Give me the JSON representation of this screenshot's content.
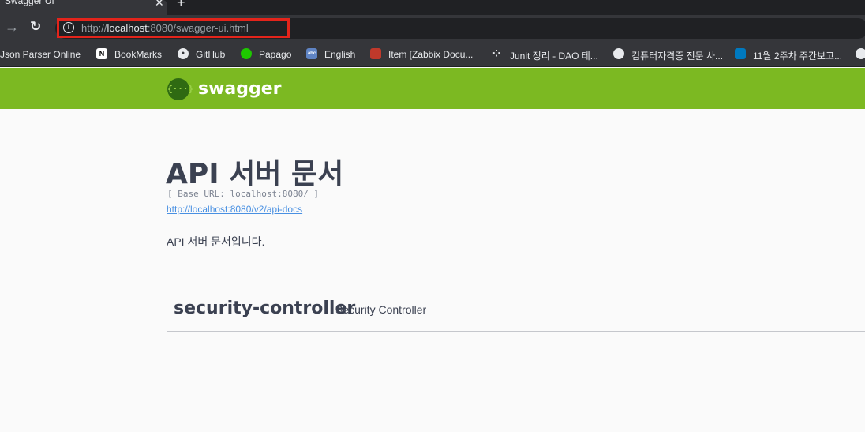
{
  "browser": {
    "tab_title": "Swagger UI",
    "tab_close": "✕",
    "new_tab": "+",
    "forward_glyph": "→",
    "reload_glyph": "↻",
    "info_glyph": "i",
    "url_scheme": "http://",
    "url_host": "localhost",
    "url_rest": ":8080/swagger-ui.html",
    "bookmarks": [
      {
        "label": "Json Parser Online",
        "icon": null
      },
      {
        "label": "BookMarks",
        "icon": "N"
      },
      {
        "label": "GitHub",
        "icon": "gh"
      },
      {
        "label": "Papago",
        "icon": "p"
      },
      {
        "label": "English",
        "icon": "abc"
      },
      {
        "label": "Item [Zabbix Docu...",
        "icon": "z"
      },
      {
        "label": "Junit 정리 - DAO 테...",
        "icon": "j"
      },
      {
        "label": "컴퓨터자격증 전문 사...",
        "icon": "c"
      },
      {
        "label": "11월 2주차 주간보고...",
        "icon": "t"
      }
    ]
  },
  "swagger": {
    "logo_glyph": "{···}",
    "brand": "swagger"
  },
  "info": {
    "title": "API 서버 문서",
    "base_url": "[ Base URL: localhost:8080/ ]",
    "docs_link": "http://localhost:8080/v2/api-docs",
    "description": "API 서버 문서입니다."
  },
  "tag": {
    "name": "security-controller",
    "description": "Security Controller"
  },
  "colors": {
    "swagger_green": "#7cb922",
    "url_highlight": "#e3241b",
    "link": "#4990e2"
  }
}
